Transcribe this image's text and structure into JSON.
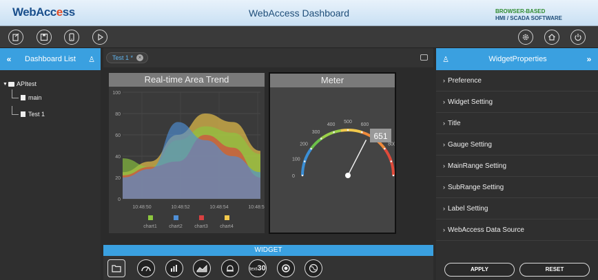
{
  "header": {
    "logo_main": "WebAcc",
    "logo_accent": "e",
    "logo_tail": "ss",
    "title": "WebAccess Dashboard",
    "brand_line1": "BROWSER-BASED",
    "brand_line2": "HMI / SCADA  SOFTWARE"
  },
  "toolbar": {
    "left_icons": [
      "export-icon",
      "save-icon",
      "mobile-icon",
      "play-icon"
    ],
    "right_icons": [
      "settings-icon",
      "home-icon",
      "power-icon"
    ]
  },
  "left_panel": {
    "collapse": "«",
    "title": "Dashboard List",
    "pin": "♙",
    "tree": {
      "root": "APItest",
      "children": [
        "main",
        "Test 1"
      ]
    }
  },
  "center": {
    "tab": {
      "label": "Test 1 *",
      "close": "×"
    },
    "widgets": {
      "trend": {
        "title": "Real-time Area Trend",
        "chart_data": {
          "type": "area",
          "x": [
            "10:48:50",
            "10:48:52",
            "10:48:54",
            "10:48:56"
          ],
          "ylim": [
            0,
            100
          ],
          "yticks": [
            "100",
            "80",
            "60",
            "40",
            "20",
            "0"
          ],
          "series": [
            {
              "name": "chart1",
              "color": "#8cc63f",
              "values": [
                38,
                30,
                55,
                68,
                62,
                42
              ]
            },
            {
              "name": "chart2",
              "color": "#4f8fd6",
              "values": [
                20,
                28,
                72,
                55,
                40,
                25
              ]
            },
            {
              "name": "chart3",
              "color": "#d94141",
              "values": [
                22,
                30,
                35,
                60,
                48,
                20
              ]
            },
            {
              "name": "chart4",
              "color": "#f2c94c",
              "values": [
                25,
                35,
                60,
                80,
                72,
                45
              ]
            }
          ]
        }
      },
      "meter": {
        "title": "Meter",
        "value": "651",
        "chart_data": {
          "type": "gauge",
          "min": 0,
          "max": 1000,
          "value": 651,
          "ticks": [
            "0",
            "100",
            "200",
            "300",
            "400",
            "500",
            "600",
            "700",
            "800",
            "900",
            "1000"
          ]
        }
      }
    },
    "widget_bar": {
      "title": "WIDGET",
      "items": [
        "folder-icon",
        "gauge-icon",
        "bar-chart-icon",
        "area-chart-icon",
        "alarm-icon",
        "text-icon",
        "circle-icon",
        "globe-icon"
      ],
      "text_label": "text",
      "text_number": "30"
    }
  },
  "right_panel": {
    "pin": "♙",
    "title": "WidgetProperties",
    "expand": "»",
    "items": [
      "Preference",
      "Widget Setting",
      "Title",
      "Gauge Setting",
      "MainRange Setting",
      "SubRange Setting",
      "Label Setting",
      "WebAccess Data Source"
    ],
    "apply": "APPLY",
    "reset": "RESET"
  }
}
